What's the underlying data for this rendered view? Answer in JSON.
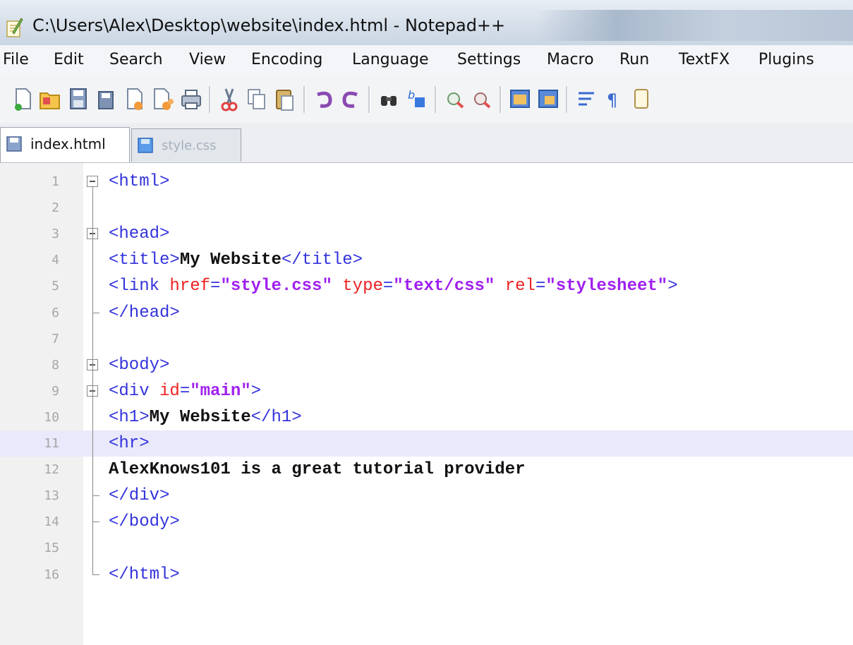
{
  "window": {
    "title": "C:\\Users\\Alex\\Desktop\\website\\index.html - Notepad++"
  },
  "menu": [
    "File",
    "Edit",
    "Search",
    "View",
    "Encoding",
    "Language",
    "Settings",
    "Macro",
    "Run",
    "TextFX",
    "Plugins"
  ],
  "toolbar_icons": [
    "new-file-icon",
    "open-file-icon",
    "save-icon",
    "save-all-icon",
    "close-icon",
    "close-all-icon",
    "print-icon",
    "cut-icon",
    "copy-icon",
    "paste-icon",
    "undo-icon",
    "redo-icon",
    "find-icon",
    "replace-icon",
    "zoom-in-icon",
    "zoom-out-icon",
    "sync-vertical-icon",
    "sync-horizontal-icon",
    "word-wrap-icon",
    "show-all-chars-icon"
  ],
  "tabs": [
    {
      "label": "index.html",
      "active": true
    },
    {
      "label": "style.css",
      "active": false
    }
  ],
  "editor": {
    "current_line": 11,
    "lines": [
      {
        "n": "1",
        "segments": [
          [
            "tag",
            "<html>"
          ]
        ]
      },
      {
        "n": "2",
        "segments": []
      },
      {
        "n": "3",
        "segments": [
          [
            "tag",
            "<head>"
          ]
        ]
      },
      {
        "n": "4",
        "segments": [
          [
            "tag",
            "<title>"
          ],
          [
            "txt",
            "My Website"
          ],
          [
            "tag",
            "</title>"
          ]
        ]
      },
      {
        "n": "5",
        "segments": [
          [
            "tag",
            "<link "
          ],
          [
            "attr",
            "href"
          ],
          [
            "tag",
            "="
          ],
          [
            "str",
            "\"style.css\""
          ],
          [
            "tag",
            " "
          ],
          [
            "attr",
            "type"
          ],
          [
            "tag",
            "="
          ],
          [
            "str",
            "\"text/css\""
          ],
          [
            "tag",
            " "
          ],
          [
            "attr",
            "rel"
          ],
          [
            "tag",
            "="
          ],
          [
            "str",
            "\"stylesheet\""
          ],
          [
            "tag",
            ">"
          ]
        ]
      },
      {
        "n": "6",
        "segments": [
          [
            "tag",
            "</head>"
          ]
        ]
      },
      {
        "n": "7",
        "segments": []
      },
      {
        "n": "8",
        "segments": [
          [
            "tag",
            "<body>"
          ]
        ]
      },
      {
        "n": "9",
        "segments": [
          [
            "tag",
            "<div "
          ],
          [
            "attr",
            "id"
          ],
          [
            "tag",
            "="
          ],
          [
            "str",
            "\"main\""
          ],
          [
            "tag",
            ">"
          ]
        ]
      },
      {
        "n": "10",
        "segments": [
          [
            "tag",
            "<h1>"
          ],
          [
            "txt",
            "My Website"
          ],
          [
            "tag",
            "</h1>"
          ]
        ]
      },
      {
        "n": "11",
        "segments": [
          [
            "tag",
            "<hr>"
          ]
        ]
      },
      {
        "n": "12",
        "segments": [
          [
            "txt",
            "AlexKnows101 is a great tutorial provider"
          ]
        ]
      },
      {
        "n": "13",
        "segments": [
          [
            "tag",
            "</div>"
          ]
        ]
      },
      {
        "n": "14",
        "segments": [
          [
            "tag",
            "</body>"
          ]
        ]
      },
      {
        "n": "15",
        "segments": []
      },
      {
        "n": "16",
        "segments": [
          [
            "tag",
            "</html>"
          ]
        ]
      }
    ]
  }
}
